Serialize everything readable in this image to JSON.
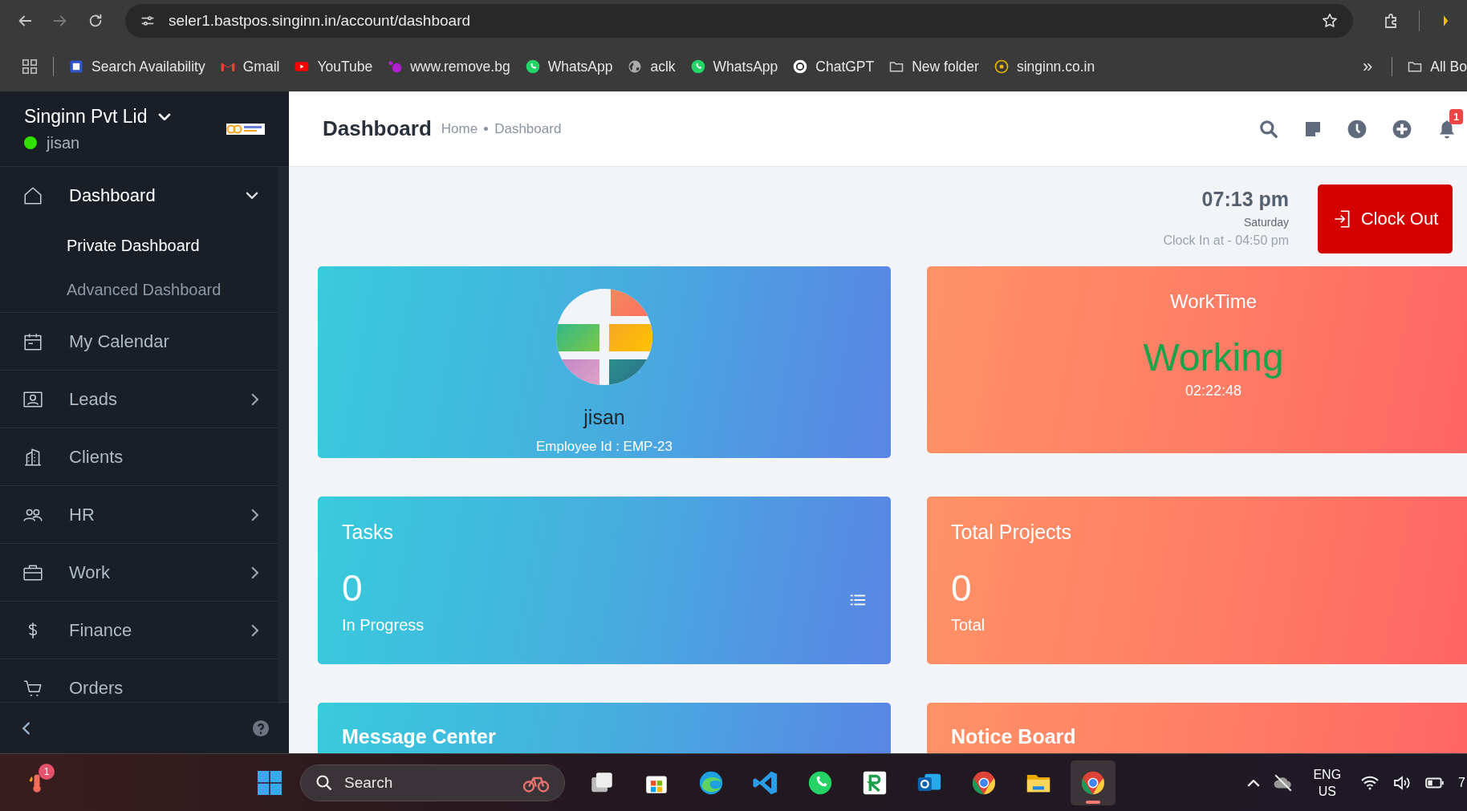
{
  "browser": {
    "url": "seler1.bastpos.singinn.in/account/dashboard",
    "bookmarks": [
      "Search Availability",
      "Gmail",
      "YouTube",
      "www.remove.bg",
      "WhatsApp",
      "aclk",
      "WhatsApp",
      "ChatGPT",
      "New folder",
      "singinn.co.in"
    ],
    "overflow": "»",
    "all_bookmarks": "All Bo"
  },
  "sidebar": {
    "company": "Singinn Pvt Lid",
    "user": "jisan",
    "online": true,
    "items": [
      {
        "label": "Dashboard",
        "kind": "group",
        "expanded": true,
        "children": [
          {
            "label": "Private Dashboard",
            "selected": true
          },
          {
            "label": "Advanced Dashboard",
            "selected": false
          }
        ]
      },
      {
        "label": "My Calendar",
        "kind": "link"
      },
      {
        "label": "Leads",
        "kind": "group",
        "expanded": false
      },
      {
        "label": "Clients",
        "kind": "link"
      },
      {
        "label": "HR",
        "kind": "group",
        "expanded": false
      },
      {
        "label": "Work",
        "kind": "group",
        "expanded": false
      },
      {
        "label": "Finance",
        "kind": "group",
        "expanded": false
      },
      {
        "label": "Orders",
        "kind": "link"
      }
    ]
  },
  "header": {
    "title": "Dashboard",
    "breadcrumb": [
      "Home",
      "Dashboard"
    ],
    "notification_count": "1"
  },
  "clock": {
    "time": "07:13 pm",
    "day": "Saturday",
    "clock_in": "Clock In at - 04:50 pm",
    "button": "Clock Out"
  },
  "profile": {
    "name": "jisan",
    "employee_id": "Employee Id : EMP-23"
  },
  "worktime": {
    "title": "WorkTime",
    "status": "Working",
    "duration": "02:22:48"
  },
  "stats": [
    {
      "title": "Tasks",
      "value": "0",
      "caption": "In Progress",
      "kind": "blue"
    },
    {
      "title": "Total Projects",
      "value": "0",
      "caption": "Total",
      "kind": "orange"
    }
  ],
  "panels": [
    {
      "title": "Message Center",
      "kind": "blue"
    },
    {
      "title": "Notice Board",
      "kind": "orange"
    }
  ],
  "taskbar": {
    "widget_badge": "1",
    "search_placeholder": "Search",
    "apps": [
      {
        "active": false
      },
      {
        "active": false
      },
      {
        "active": false
      },
      {
        "active": false
      },
      {
        "active": false
      },
      {
        "active": false
      },
      {
        "active": false
      },
      {
        "active": false
      },
      {
        "active": false
      },
      {
        "active": true
      }
    ],
    "language": "ENG",
    "region": "US",
    "clock": "7"
  }
}
